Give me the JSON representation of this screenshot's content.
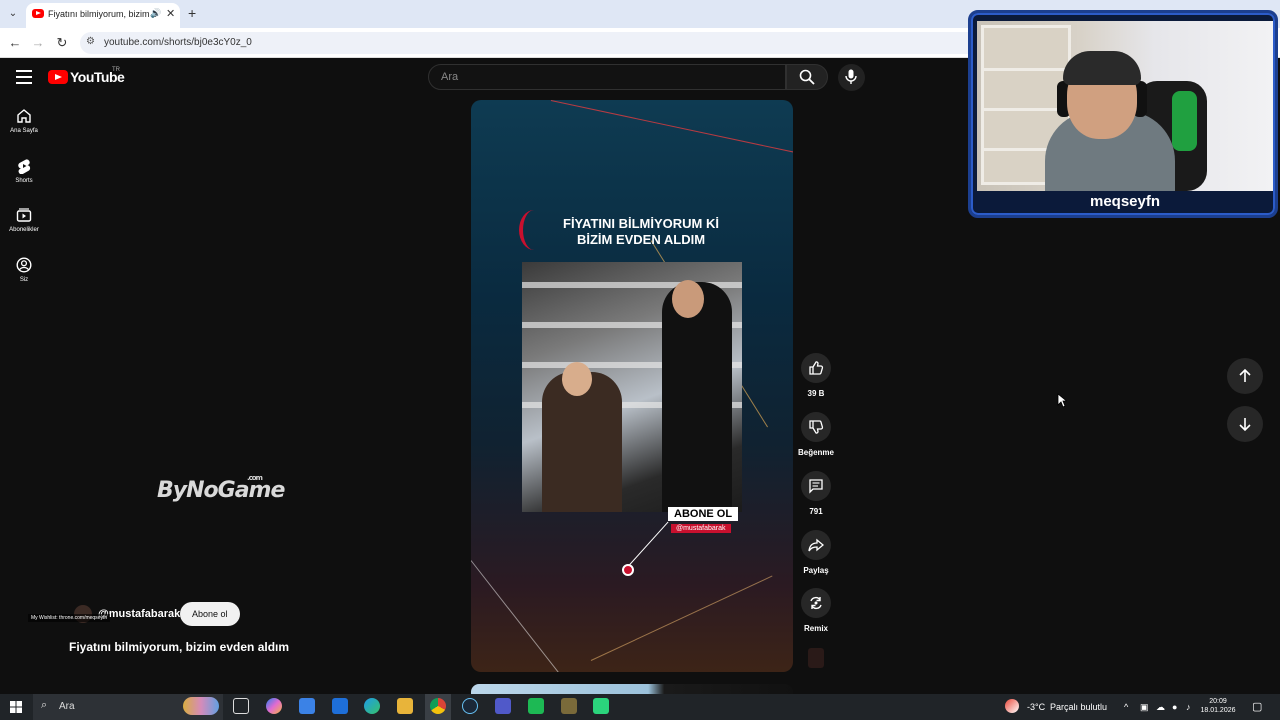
{
  "browser": {
    "tab_title": "Fiyatını bilmiyorum, bizim e",
    "url": "youtube.com/shorts/bj0e3cY0z_0"
  },
  "youtube": {
    "logo": "YouTube",
    "country_code": "TR",
    "search_placeholder": "Ara",
    "sidebar": [
      {
        "label": "Ana Sayfa",
        "icon": "home-icon"
      },
      {
        "label": "Shorts",
        "icon": "shorts-icon"
      },
      {
        "label": "Abonelikler",
        "icon": "subscriptions-icon"
      },
      {
        "label": "Siz",
        "icon": "account-icon"
      }
    ]
  },
  "short": {
    "headline_line1": "FİYATINI BİLMİYORUM Kİ",
    "headline_line2": "BİZİM EVDEN ALDIM",
    "subscribe_cta": "ABONE OL",
    "handle_overlay": "@mustafabarak",
    "channel_name": "@mustafabarak",
    "subscribe_button": "Abone ol",
    "title": "Fiyatını bilmiyorum, bizim evden aldım",
    "wishlist_text": "My Wishlist: throne.com/meqseyfn"
  },
  "actions": {
    "likes": "39 B",
    "dislike_label": "Beğenme",
    "comments": "791",
    "share_label": "Paylaş",
    "remix_label": "Remix"
  },
  "overlay": {
    "watermark": "ByNoGame",
    "watermark_suffix": ".com",
    "streamer_name": "meqseyfn"
  },
  "taskbar": {
    "search_placeholder": "Ara",
    "weather": "-3°C",
    "weather_desc": "Parçalı bulutlu",
    "time": "20:09",
    "date": "18.01.2026"
  },
  "colors": {
    "youtube_red": "#ff0000",
    "background": "#0f0f0f",
    "cam_frame": "#1c3f8f"
  }
}
